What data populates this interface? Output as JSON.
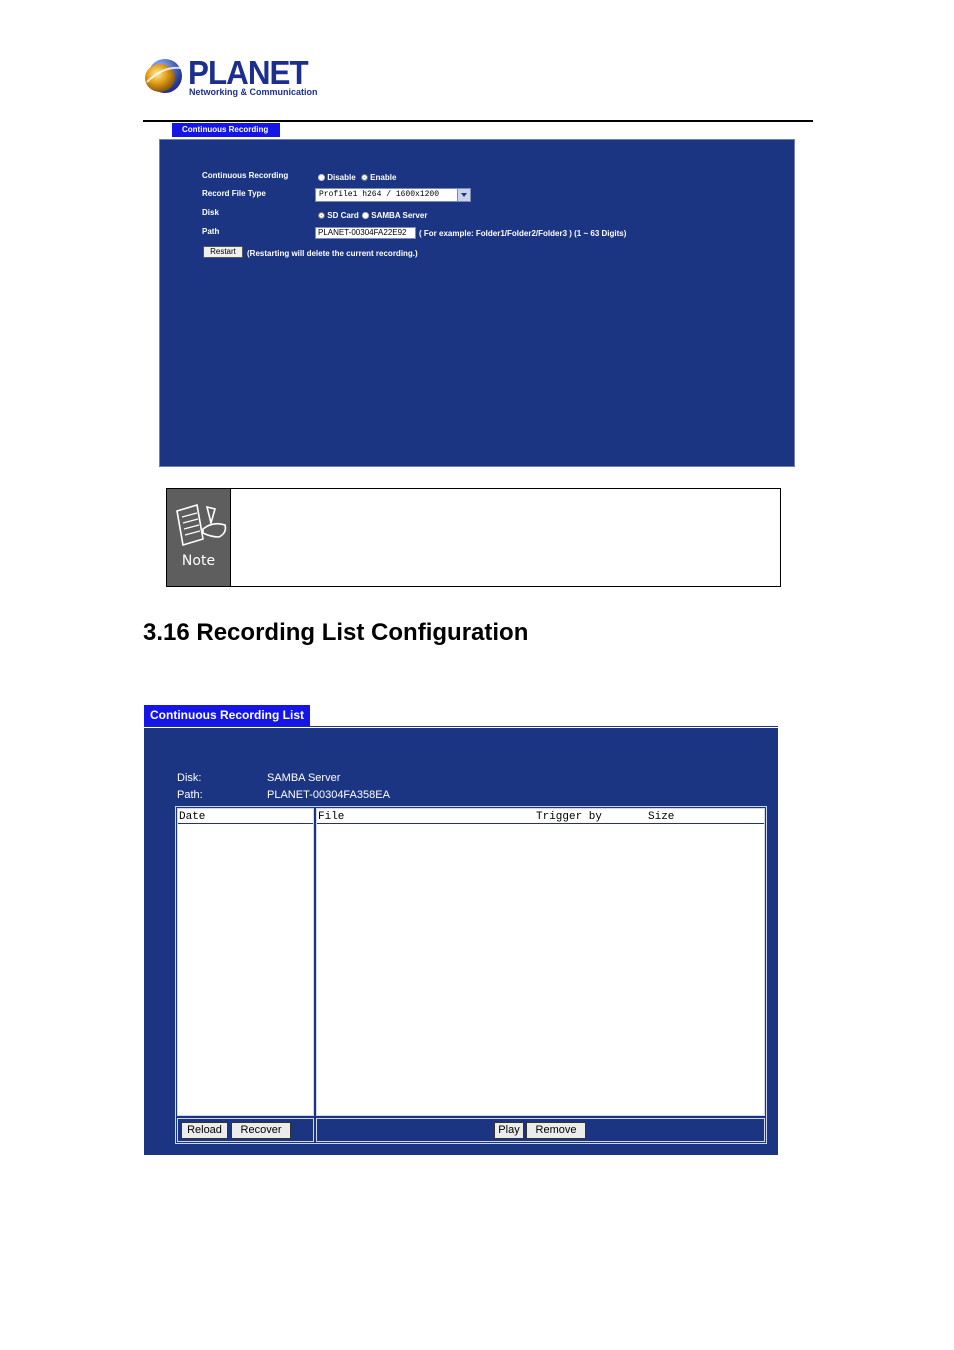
{
  "header": {
    "brand": "PLANET",
    "tagline": "Networking & Communication"
  },
  "recording_panel": {
    "tab_title": "Continuous Recording",
    "continuous_recording_label": "Continuous Recording",
    "disable_label": "Disable",
    "enable_label": "Enable",
    "selected_mode": "Enable",
    "record_file_type_label": "Record File Type",
    "record_file_type_value": "Profile1 h264 / 1600x1200",
    "disk_label": "Disk",
    "sd_card_label": "SD Card",
    "samba_label": "SAMBA Server",
    "selected_disk": "SD Card",
    "path_label": "Path",
    "path_value": "PLANET-00304FA22E92",
    "path_hint": "( For example: Folder1/Folder2/Folder3 ) (1 ~ 63 Digits)",
    "restart_button": "Restart",
    "restart_note": "(Restarting will delete the current recording.)"
  },
  "note": {
    "icon_label": "Note"
  },
  "section": {
    "title": "3.16 Recording List Configuration"
  },
  "list_panel": {
    "tab_title": "Continuous Recording List",
    "disk_label": "Disk:",
    "disk_value": "SAMBA Server",
    "path_label": "Path:",
    "path_value": "PLANET-00304FA358EA",
    "columns": {
      "date": "Date",
      "file": "File",
      "trigger_by": "Trigger by",
      "size": "Size"
    },
    "buttons": {
      "reload": "Reload",
      "recover": "Recover",
      "play": "Play",
      "remove": "Remove"
    }
  },
  "colors": {
    "panel_bg": "#1b3583",
    "tab_bg": "#1515e8",
    "brand": "#1c2f8c"
  }
}
